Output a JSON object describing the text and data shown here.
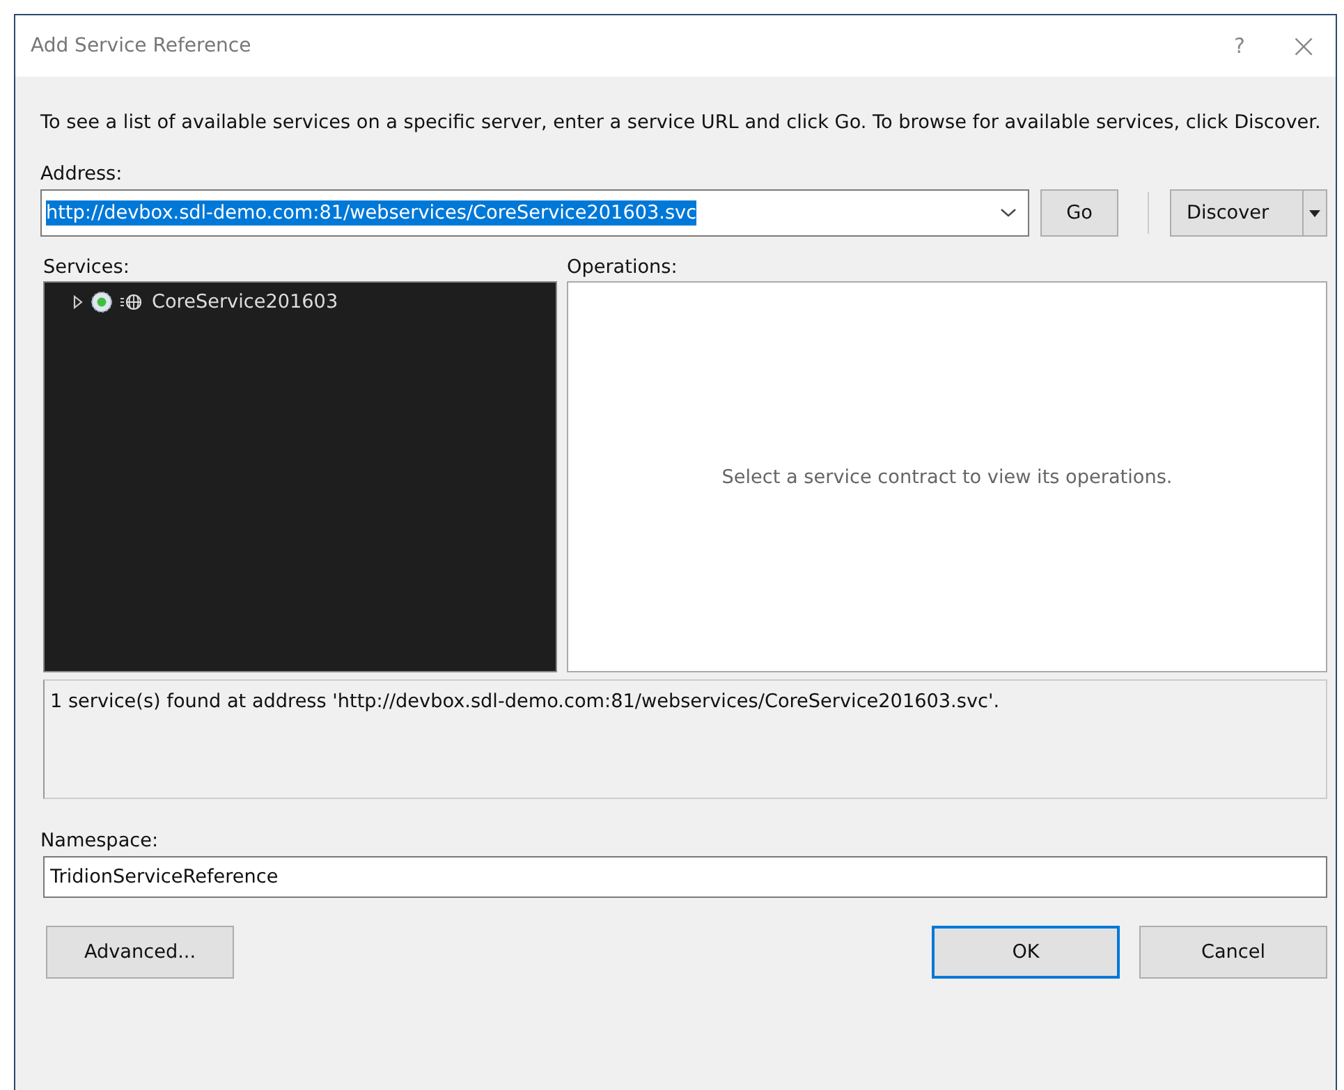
{
  "window": {
    "title": "Add Service Reference",
    "help_button": "?",
    "close_button": "×"
  },
  "instructions": "To see a list of available services on a specific server, enter a service URL and click Go. To browse for available services, click Discover.",
  "address": {
    "label": "Address:",
    "value": "http://devbox.sdl-demo.com:81/webservices/CoreService201603.svc",
    "text_selected": true
  },
  "go_button": "Go",
  "discover_button": "Discover",
  "services": {
    "label": "Services:",
    "items": [
      {
        "label": "CoreService201603",
        "expanded": false
      }
    ]
  },
  "operations": {
    "label": "Operations:",
    "empty_message": "Select a service contract to view its operations."
  },
  "status": "1 service(s) found at address 'http://devbox.sdl-demo.com:81/webservices/CoreService201603.svc'.",
  "namespace": {
    "label": "Namespace:",
    "value": "TridionServiceReference"
  },
  "buttons": [
    {
      "kind": "advanced",
      "label": "Advanced...",
      "default": false
    },
    {
      "kind": "ok",
      "label": "OK",
      "default": true
    },
    {
      "kind": "cancel",
      "label": "Cancel",
      "default": false
    }
  ]
}
